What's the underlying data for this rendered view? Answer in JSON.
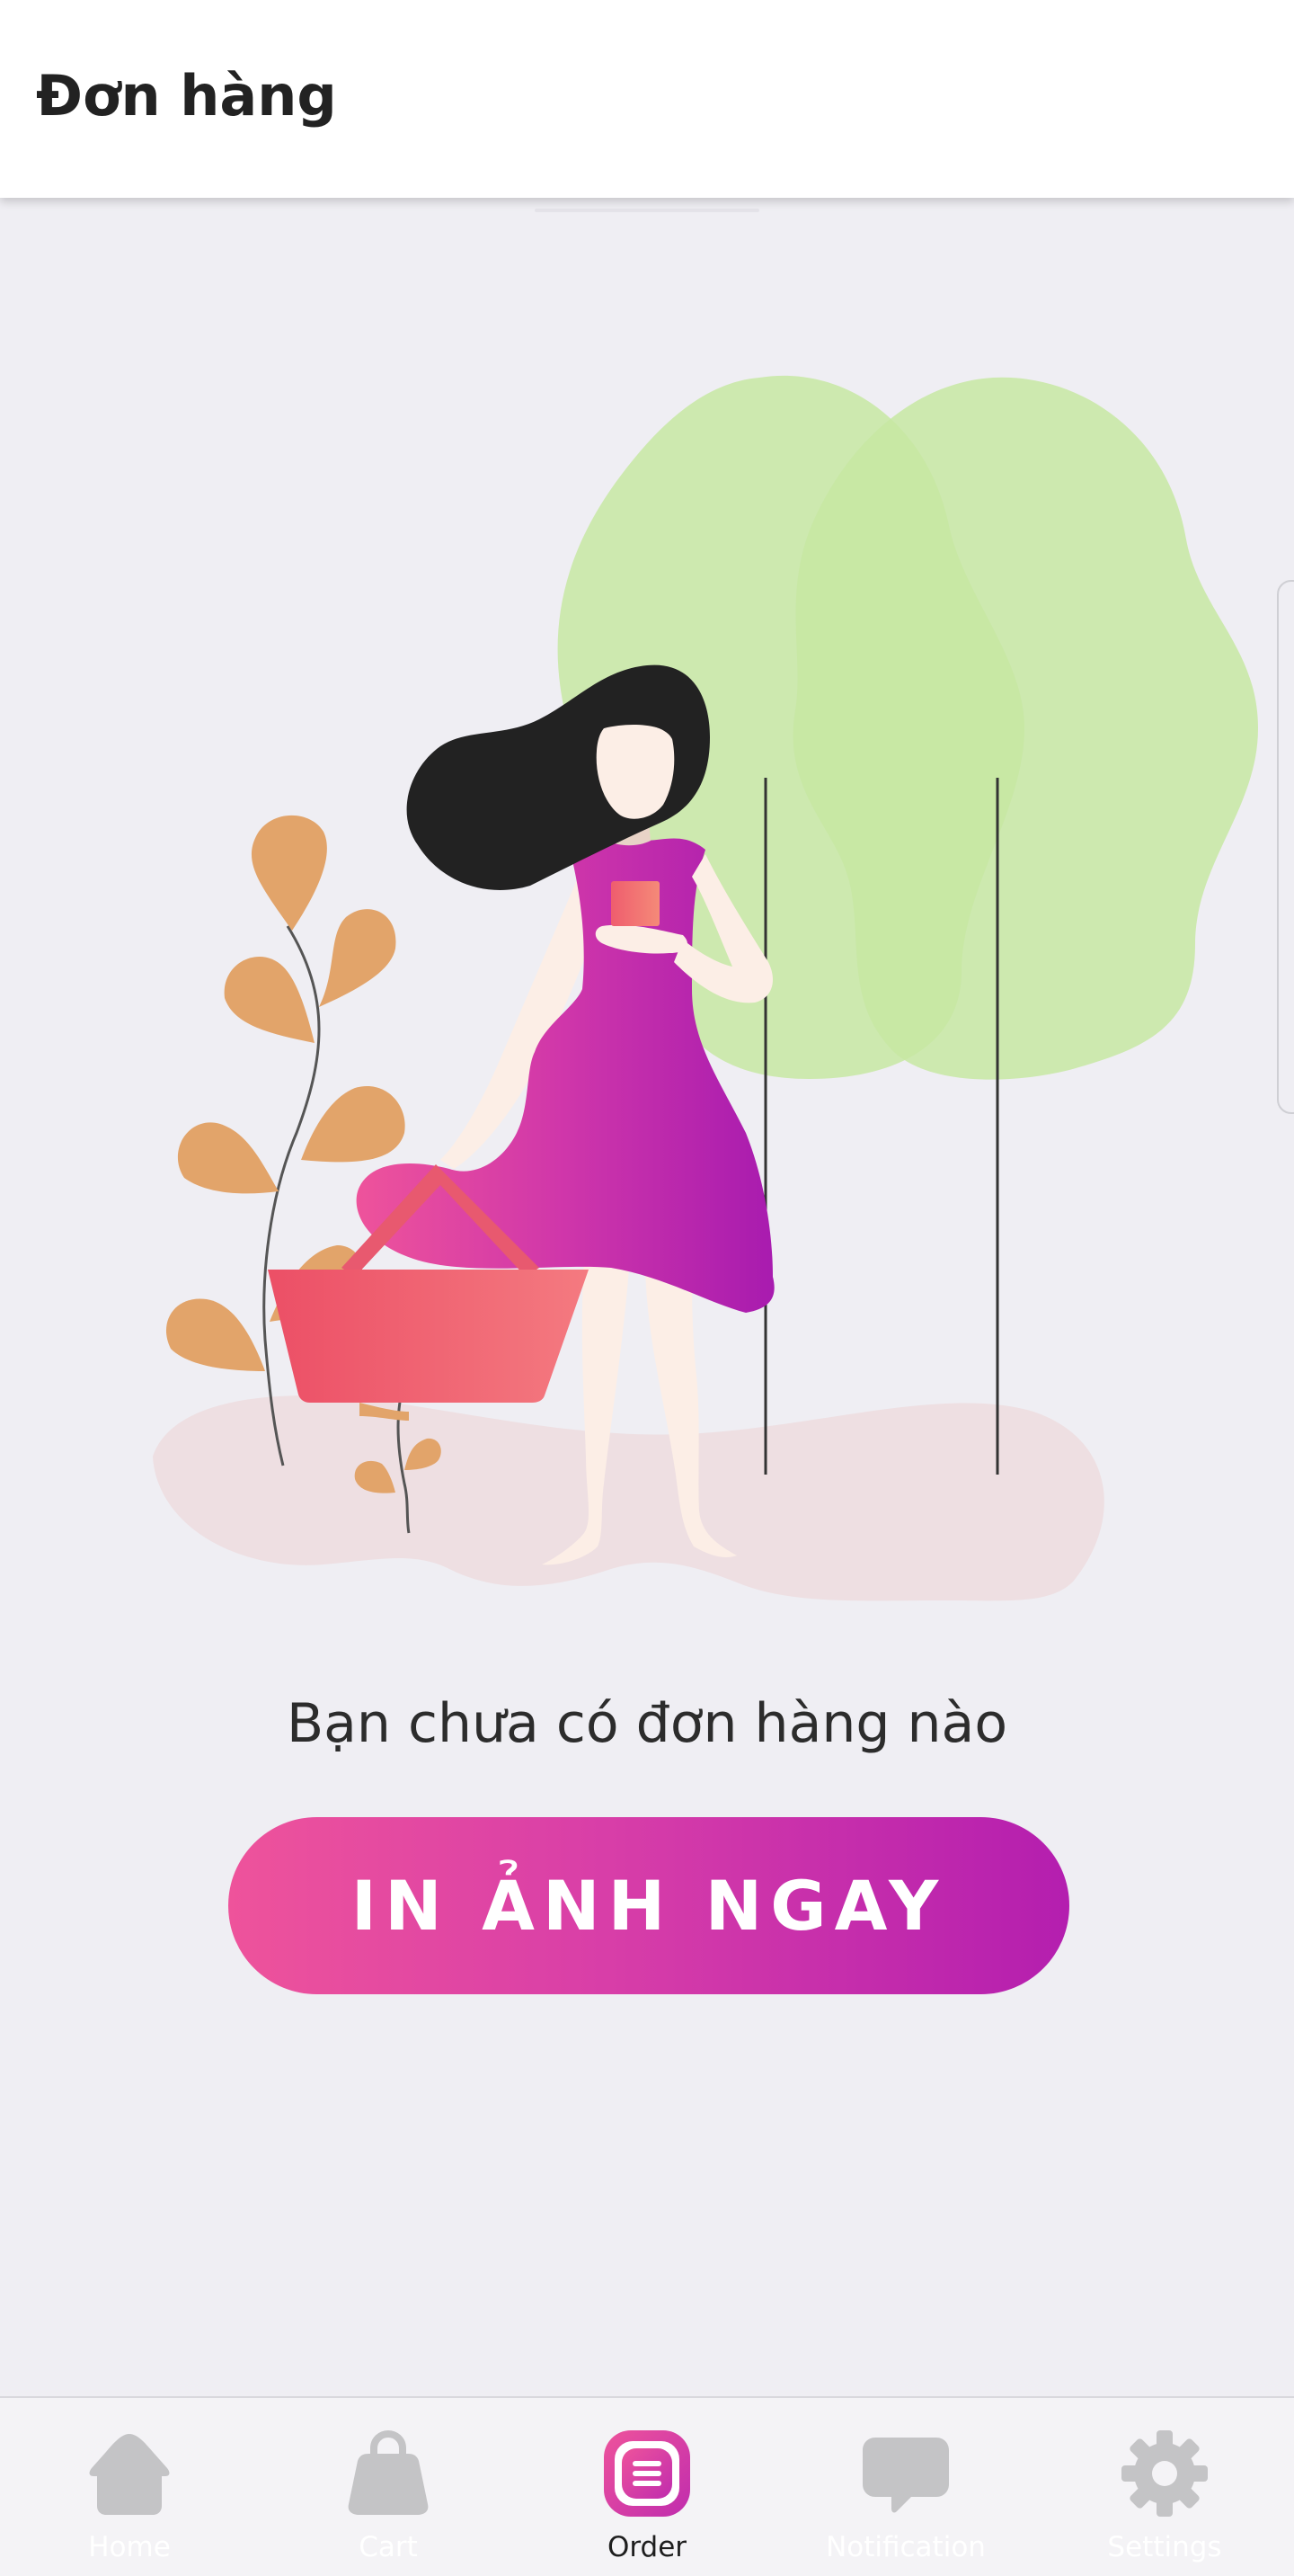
{
  "header": {
    "title": "Đơn hàng"
  },
  "empty_state": {
    "message": "Bạn chưa có đơn hàng nào",
    "cta_label": "IN ẢNH NGAY"
  },
  "bottom_nav": {
    "items": [
      {
        "label": "Home",
        "icon": "home-icon",
        "active": false
      },
      {
        "label": "Cart",
        "icon": "shopping-bag-icon",
        "active": false
      },
      {
        "label": "Order",
        "icon": "order-list-icon",
        "active": true
      },
      {
        "label": "Notification",
        "icon": "chat-bubble-icon",
        "active": false
      },
      {
        "label": "Settings",
        "icon": "gear-icon",
        "active": false
      }
    ]
  },
  "colors": {
    "accent_start": "#EE539B",
    "accent_end": "#B41EAF",
    "inactive_icon": "#C4C4C6",
    "background": "#EFEEF3"
  }
}
